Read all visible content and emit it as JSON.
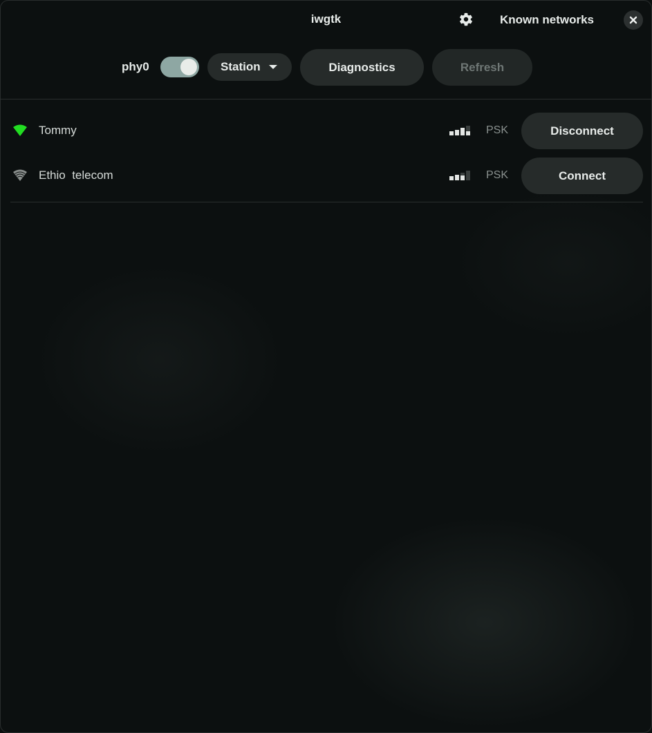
{
  "window": {
    "title": "iwgtk"
  },
  "header": {
    "settings_icon": "gear-icon",
    "known_networks_label": "Known networks",
    "close_icon": "close-icon"
  },
  "toolbar": {
    "device_label": "phy0",
    "device_enabled": true,
    "mode_label": "Station",
    "diagnostics_label": "Diagnostics",
    "refresh_label": "Refresh"
  },
  "networks": [
    {
      "name": "Tommy",
      "connected": true,
      "icon": "wifi-connected-icon",
      "icon_color": "#22dd22",
      "signal_bars": 4,
      "security": "PSK",
      "action_label": "Disconnect"
    },
    {
      "name": "Ethio  telecom",
      "connected": false,
      "icon": "wifi-icon",
      "icon_color": "#8a8f8d",
      "signal_bars": 3,
      "security": "PSK",
      "action_label": "Connect"
    }
  ],
  "colors": {
    "background": "#0c1010",
    "button_bg": "#262b2a",
    "toggle_on": "#8ea7a3",
    "connected_green": "#22dd22"
  }
}
